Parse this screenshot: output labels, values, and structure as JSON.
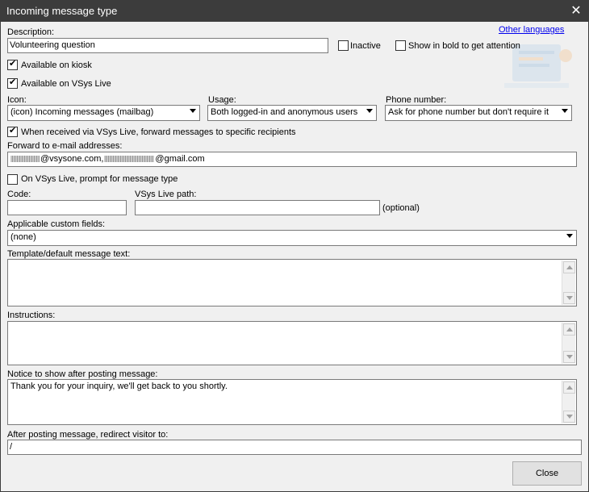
{
  "window": {
    "title": "Incoming message type"
  },
  "links": {
    "other_languages": "Other languages"
  },
  "description": {
    "label": "Description:",
    "value": "Volunteering question"
  },
  "checkboxes": {
    "inactive": {
      "label": "Inactive",
      "checked": false
    },
    "bold": {
      "label": "Show in bold to get attention",
      "checked": false
    },
    "kiosk": {
      "label": "Available on kiosk",
      "checked": true
    },
    "vsys_live": {
      "label": "Available on VSys Live",
      "checked": true
    },
    "forward": {
      "label": "When received via VSys Live, forward messages to specific recipients",
      "checked": true
    },
    "prompt_type": {
      "label": "On VSys Live, prompt for message type",
      "checked": false
    }
  },
  "icon": {
    "label": "Icon:",
    "value": "(icon) Incoming messages (mailbag)"
  },
  "usage": {
    "label": "Usage:",
    "value": "Both logged-in and anonymous users"
  },
  "phone": {
    "label": "Phone number:",
    "value": "Ask for phone number but don't require it"
  },
  "forward_emails": {
    "label": "Forward to e-mail addresses:",
    "part1": "@vsysone.com,",
    "part2": "@gmail.com"
  },
  "code": {
    "label": "Code:",
    "value": ""
  },
  "path": {
    "label": "VSys Live path:",
    "value": "",
    "optional": "(optional)"
  },
  "custom_fields": {
    "label": "Applicable custom fields:",
    "value": "(none)"
  },
  "template": {
    "label": "Template/default message text:",
    "value": ""
  },
  "instructions": {
    "label": "Instructions:",
    "value": ""
  },
  "notice": {
    "label": "Notice to show after posting message:",
    "value": "Thank you for your inquiry, we'll get back to you shortly."
  },
  "redirect": {
    "label": "After posting message, redirect visitor to:",
    "value": "/"
  },
  "buttons": {
    "close": "Close"
  },
  "icons": {
    "close": "close-icon",
    "check": "checkmark-icon",
    "dropdown": "chevron-down-icon"
  }
}
